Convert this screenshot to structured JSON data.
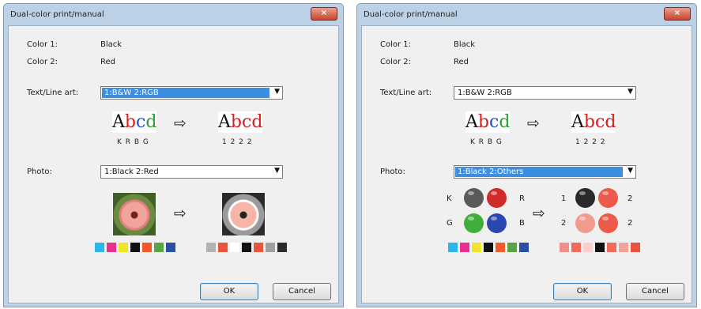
{
  "dialogs": [
    {
      "title": "Dual-color print/manual",
      "close_glyph": "×",
      "color1_label": "Color 1:",
      "color1_value": "Black",
      "color2_label": "Color 2:",
      "color2_value": "Red",
      "text_label": "Text/Line art:",
      "text_value": "1:B&W 2:RGB",
      "text_focused": true,
      "photo_label": "Photo:",
      "photo_value": "1:Black 2:Red",
      "photo_focused": false,
      "sample_text_codes": "K R B G",
      "result_text_codes": "1 2 2 2",
      "ok": "OK",
      "cancel": "Cancel",
      "swatches_before": [
        "#29b6e8",
        "#e6318f",
        "#f2e529",
        "#111111",
        "#f05a28",
        "#5aa347",
        "#2a4ea0"
      ],
      "swatches_after": [
        "#b2b2b2",
        "#e8553e",
        "#ffffff",
        "#111111",
        "#e8553e",
        "#a0a0a0",
        "#2b2b2b"
      ]
    },
    {
      "title": "Dual-color print/manual",
      "close_glyph": "×",
      "color1_label": "Color 1:",
      "color1_value": "Black",
      "color2_label": "Color 2:",
      "color2_value": "Red",
      "text_label": "Text/Line art:",
      "text_value": "1:B&W 2:RGB",
      "text_focused": false,
      "photo_label": "Photo:",
      "photo_value": "1:Black 2:Others",
      "photo_focused": true,
      "sample_text_codes": "K R B G",
      "result_text_codes": "1 2 2 2",
      "ball_labels_left": [
        "K",
        "R",
        "G",
        "B"
      ],
      "ball_labels_right": [
        "1",
        "2",
        "2",
        "2"
      ],
      "ok": "OK",
      "cancel": "Cancel",
      "swatches_before": [
        "#29b6e8",
        "#e6318f",
        "#f2e529",
        "#111111",
        "#f05a28",
        "#5aa347",
        "#2a4ea0"
      ],
      "swatches_after": [
        "#f0908a",
        "#f26a5c",
        "#fbd0cc",
        "#111111",
        "#f26a5c",
        "#f4a39a",
        "#e8553e"
      ]
    }
  ],
  "sample_letters": [
    "A",
    "b",
    "c",
    "d"
  ],
  "sample_colors": [
    "#111111",
    "#d42020",
    "#2a4fc0",
    "#2e9e3a"
  ],
  "result_colors": [
    "#111111",
    "#d42020",
    "#d42020",
    "#d42020"
  ]
}
